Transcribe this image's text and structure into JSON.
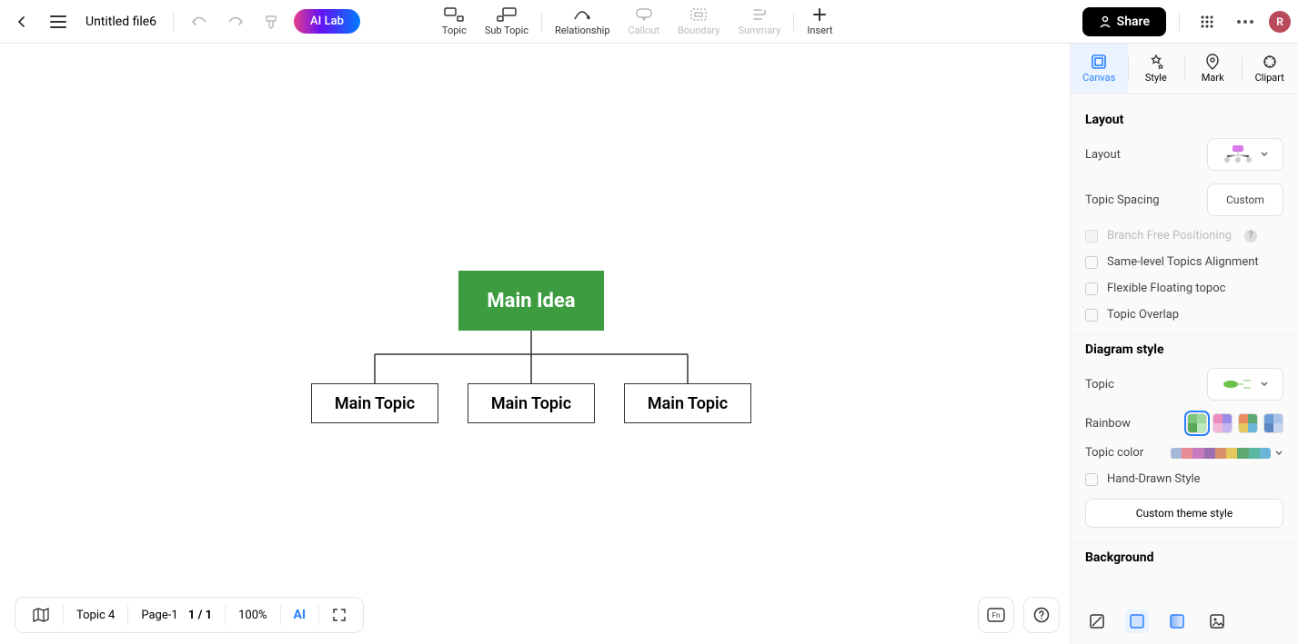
{
  "header": {
    "filename": "Untitled file6",
    "ai_lab": "AI Lab",
    "share": "Share",
    "avatar_initial": "R",
    "tools": {
      "topic": "Topic",
      "subtopic": "Sub Topic",
      "relationship": "Relationship",
      "callout": "Callout",
      "boundary": "Boundary",
      "summary": "Summary",
      "insert": "Insert"
    }
  },
  "mindmap": {
    "main": "Main Idea",
    "topics": [
      "Main Topic",
      "Main Topic",
      "Main Topic"
    ]
  },
  "right_panel": {
    "tabs": {
      "canvas": "Canvas",
      "style": "Style",
      "mark": "Mark",
      "clipart": "Clipart"
    },
    "layout": {
      "title": "Layout",
      "layout_label": "Layout",
      "spacing_label": "Topic Spacing",
      "spacing_value": "Custom",
      "branch_free": "Branch Free Positioning",
      "same_level": "Same-level Topics Alignment",
      "flexible": "Flexible Floating topoc",
      "overlap": "Topic Overlap"
    },
    "diagram": {
      "title": "Diagram style",
      "topic_label": "Topic",
      "rainbow_label": "Rainbow",
      "topic_color_label": "Topic color",
      "hand_drawn": "Hand-Drawn Style",
      "custom_theme": "Custom theme style"
    },
    "background": {
      "title": "Background"
    },
    "topic_colors": [
      "#a9b8d8",
      "#e98b94",
      "#c77bbf",
      "#9c6fb0",
      "#d9916b",
      "#e5c85e",
      "#5ea772",
      "#5ab7a3",
      "#6db5d8"
    ]
  },
  "bottombar": {
    "topic_count": "Topic 4",
    "page_label": "Page-1",
    "page_num": "1 / 1",
    "zoom": "100%",
    "ai": "AI"
  }
}
